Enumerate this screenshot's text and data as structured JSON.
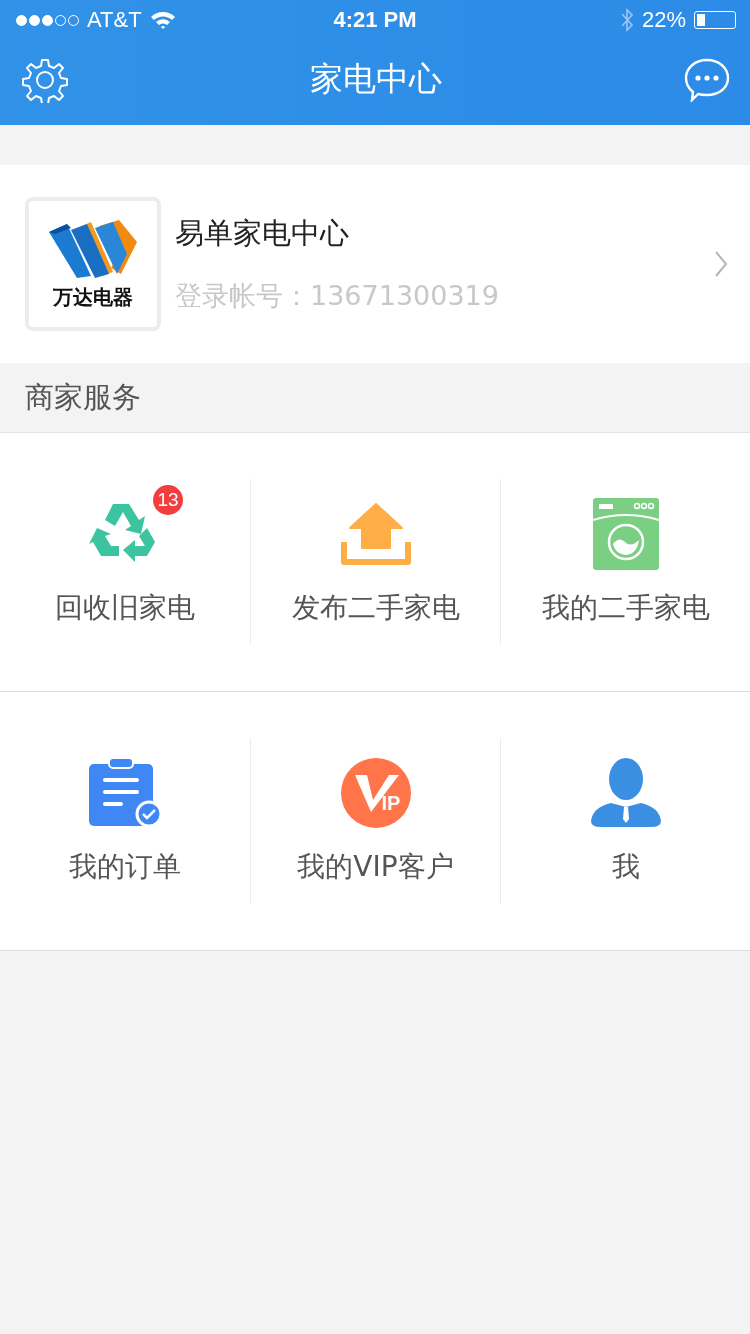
{
  "status_bar": {
    "carrier": "AT&T",
    "time": "4:21 PM",
    "battery": "22%"
  },
  "nav": {
    "title": "家电中心"
  },
  "profile": {
    "logo_text": "万达电器",
    "name": "易单家电中心",
    "account": "登录帐号：13671300319"
  },
  "section": {
    "title": "商家服务"
  },
  "services": [
    [
      {
        "kind": "recycle",
        "label": "回收旧家电",
        "badge": "13"
      },
      {
        "kind": "upload",
        "label": "发布二手家电"
      },
      {
        "kind": "washer",
        "label": "我的二手家电"
      }
    ],
    [
      {
        "kind": "order",
        "label": "我的订单"
      },
      {
        "kind": "vip",
        "label": "我的VIP客户",
        "icon_text": "IP"
      },
      {
        "kind": "person",
        "label": "我"
      }
    ]
  ]
}
